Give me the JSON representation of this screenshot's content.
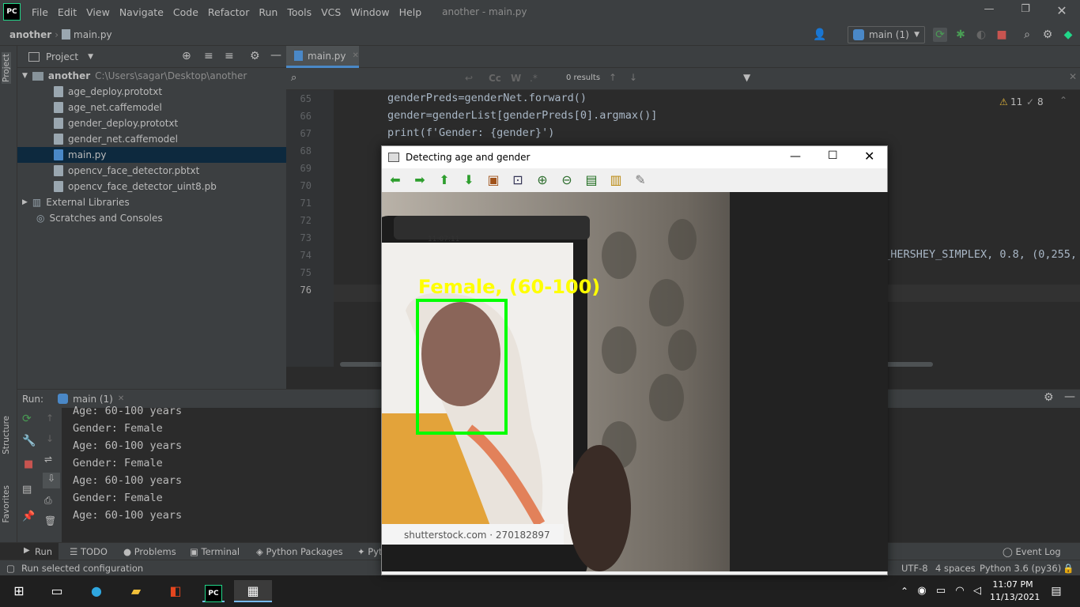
{
  "titlebar": {
    "logo": "PC",
    "menu": [
      "File",
      "Edit",
      "View",
      "Navigate",
      "Code",
      "Refactor",
      "Run",
      "Tools",
      "VCS",
      "Window",
      "Help"
    ],
    "title": "another - main.py"
  },
  "nav": {
    "project": "another",
    "file": "main.py",
    "run_config": "main (1)"
  },
  "project_panel": {
    "title": "Project",
    "root_name": "another",
    "root_path": "C:\\Users\\sagar\\Desktop\\another",
    "files": [
      "age_deploy.prototxt",
      "age_net.caffemodel",
      "gender_deploy.prototxt",
      "gender_net.caffemodel",
      "main.py",
      "opencv_face_detector.pbtxt",
      "opencv_face_detector_uint8.pb"
    ],
    "external": "External Libraries",
    "scratches": "Scratches and Consoles"
  },
  "side_tabs": {
    "project": "Project",
    "structure": "Structure",
    "favorites": "Favorites"
  },
  "editor": {
    "tab": "main.py",
    "find_results": "0 results",
    "warnings": "11",
    "weak": "8",
    "lines": [
      {
        "n": "65",
        "code": "genderPreds=genderNet.forward()"
      },
      {
        "n": "66",
        "code": "gender=genderList[genderPreds[0].argmax()]"
      },
      {
        "n": "67",
        "code": "print(f'Gender: {gender}')"
      },
      {
        "n": "68",
        "code": ""
      },
      {
        "n": "69",
        "code": ""
      },
      {
        "n": "70",
        "code": ""
      },
      {
        "n": "71",
        "code": ""
      },
      {
        "n": "72",
        "code": ""
      },
      {
        "n": "73",
        "code": ""
      },
      {
        "n": "74",
        "code": ""
      },
      {
        "n": "75",
        "code": ""
      },
      {
        "n": "76",
        "code": ""
      }
    ],
    "line74_tail": "T_HERSHEY_SIMPLEX, 0.8, (0,255,"
  },
  "run_panel": {
    "label": "Run:",
    "tab": "main (1)",
    "output": [
      "Age: 60-100 years",
      "Gender: Female",
      "Age: 60-100 years",
      "Gender: Female",
      "Age: 60-100 years",
      "Gender: Female",
      "Age: 60-100 years"
    ]
  },
  "tool_windows": {
    "run": "Run",
    "todo": "TODO",
    "problems": "Problems",
    "terminal": "Terminal",
    "packages": "Python Packages",
    "py": "Pyt",
    "event_log": "Event Log"
  },
  "status": {
    "message": "Run selected configuration",
    "encoding": "UTF-8",
    "indent": "4 spaces",
    "interpreter": "Python 3.6 (py36)"
  },
  "cv_window": {
    "title": "Detecting age and gender",
    "overlay_label": "Female, (60-100)",
    "phone_time": "11:07:11",
    "watermark": "shutterstock.com · 270182897"
  },
  "taskbar": {
    "time": "11:07 PM",
    "date": "11/13/2021"
  },
  "colors": {
    "accent": "#4a88c7",
    "overlay_yellow": "#ffff00",
    "face_box_green": "#00ff00",
    "run_green": "#499c54",
    "stop_red": "#c75450"
  }
}
